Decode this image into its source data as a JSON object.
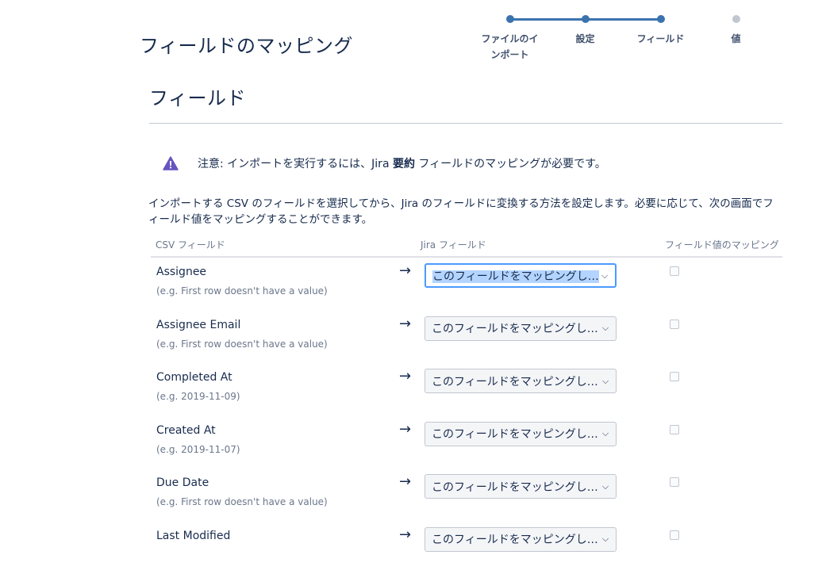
{
  "header": {
    "title": "フィールドのマッピング"
  },
  "progress": {
    "steps": [
      {
        "label": "ファイルのインポート",
        "line1": "ファイルのイ",
        "line2": "ンポート",
        "state": "done"
      },
      {
        "label": "設定",
        "state": "done"
      },
      {
        "label": "フィールド",
        "state": "current"
      },
      {
        "label": "値",
        "state": "pending"
      }
    ],
    "colors": {
      "active": "#3b73af",
      "pending": "#c1c7d0"
    }
  },
  "section": {
    "title": "フィールド"
  },
  "warning": {
    "icon": "warning-icon",
    "text_prefix": "注意: インポートを実行するには、Jira ",
    "text_bold": "要約",
    "text_suffix": " フィールドのマッピングが必要です。",
    "icon_color": "#6554c0"
  },
  "description": "インポートする CSV のフィールドを選択してから、Jira のフィールドに変換する方法を設定します。必要に応じて、次の画面でフィールド値をマッピングすることができます。",
  "table": {
    "headers": {
      "csv": "CSV フィールド",
      "jira": "Jira フィールド",
      "value_mapping": "フィールド値のマッピング"
    },
    "rows": [
      {
        "name": "Assignee",
        "example": "(e.g. First row doesn't have a value)",
        "select": "このフィールドをマッピングしない",
        "checked": false,
        "focused": true
      },
      {
        "name": "Assignee Email",
        "example": "(e.g. First row doesn't have a value)",
        "select": "このフィールドをマッピングしない",
        "checked": false
      },
      {
        "name": "Completed At",
        "example": "(e.g. 2019-11-09)",
        "select": "このフィールドをマッピングしない",
        "checked": false
      },
      {
        "name": "Created At",
        "example": "(e.g. 2019-11-07)",
        "select": "このフィールドをマッピングしない",
        "checked": false
      },
      {
        "name": "Due Date",
        "example": "(e.g. First row doesn't have a value)",
        "select": "このフィールドをマッピングしない",
        "checked": false
      },
      {
        "name": "Last Modified",
        "example": "",
        "select": "このフィールドをマッピングしない",
        "checked": false
      }
    ],
    "arrow": "→"
  }
}
